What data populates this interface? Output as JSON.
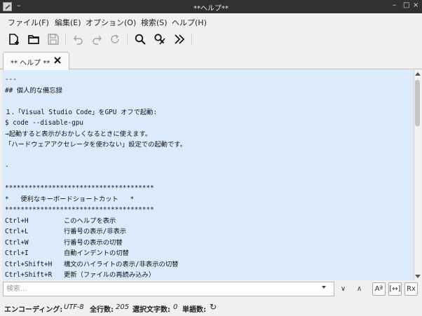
{
  "titlebar": {
    "dash": "–",
    "title": "**ヘルプ**",
    "min": "–",
    "max": "□",
    "close": "×"
  },
  "menu": [
    "ファイル(F)",
    "編集(E)",
    "オプション(O)",
    "検索(S)",
    "ヘルプ(H)"
  ],
  "tab": {
    "label": "** ヘルプ **"
  },
  "editor": {
    "lines": [
      "---",
      "## 個人的な備忘録",
      "",
      "１．「Visual Studio Code」をGPU オフで起動:",
      "$ code --disable-gpu",
      "→起動すると表示がおかしくなるときに使えます。",
      "「ハードウェアアクセレータを使わない」設定での起動です。",
      "",
      "-",
      "",
      "**************************************",
      "*   便利なキーボードショートカット   *",
      "**************************************",
      "Ctrl+H         このヘルプを表示",
      "Ctrl+L         行番号の表示/非表示",
      "Ctrl+W         行番号の表示の切替",
      "Ctrl+I         自動インデントの切替",
      "Ctrl+Shift+H   構文のハイライトの表示/非表示の切替",
      "Ctrl+Shift+R   更新（ファイルの再読み込み）"
    ]
  },
  "search": {
    "placeholder": "検索...",
    "value": "",
    "next": "∨",
    "prev": "∧",
    "case": "Aª",
    "word": "[↔]",
    "regex": "Rx"
  },
  "status": {
    "encoding_label": "エンコーディング:",
    "encoding_value": "UTF-8",
    "lines_label": "全行数:",
    "lines_value": "205",
    "sel_label": "選択文字数:",
    "sel_value": "0",
    "words_label": "単語数:",
    "refresh": "↻"
  }
}
